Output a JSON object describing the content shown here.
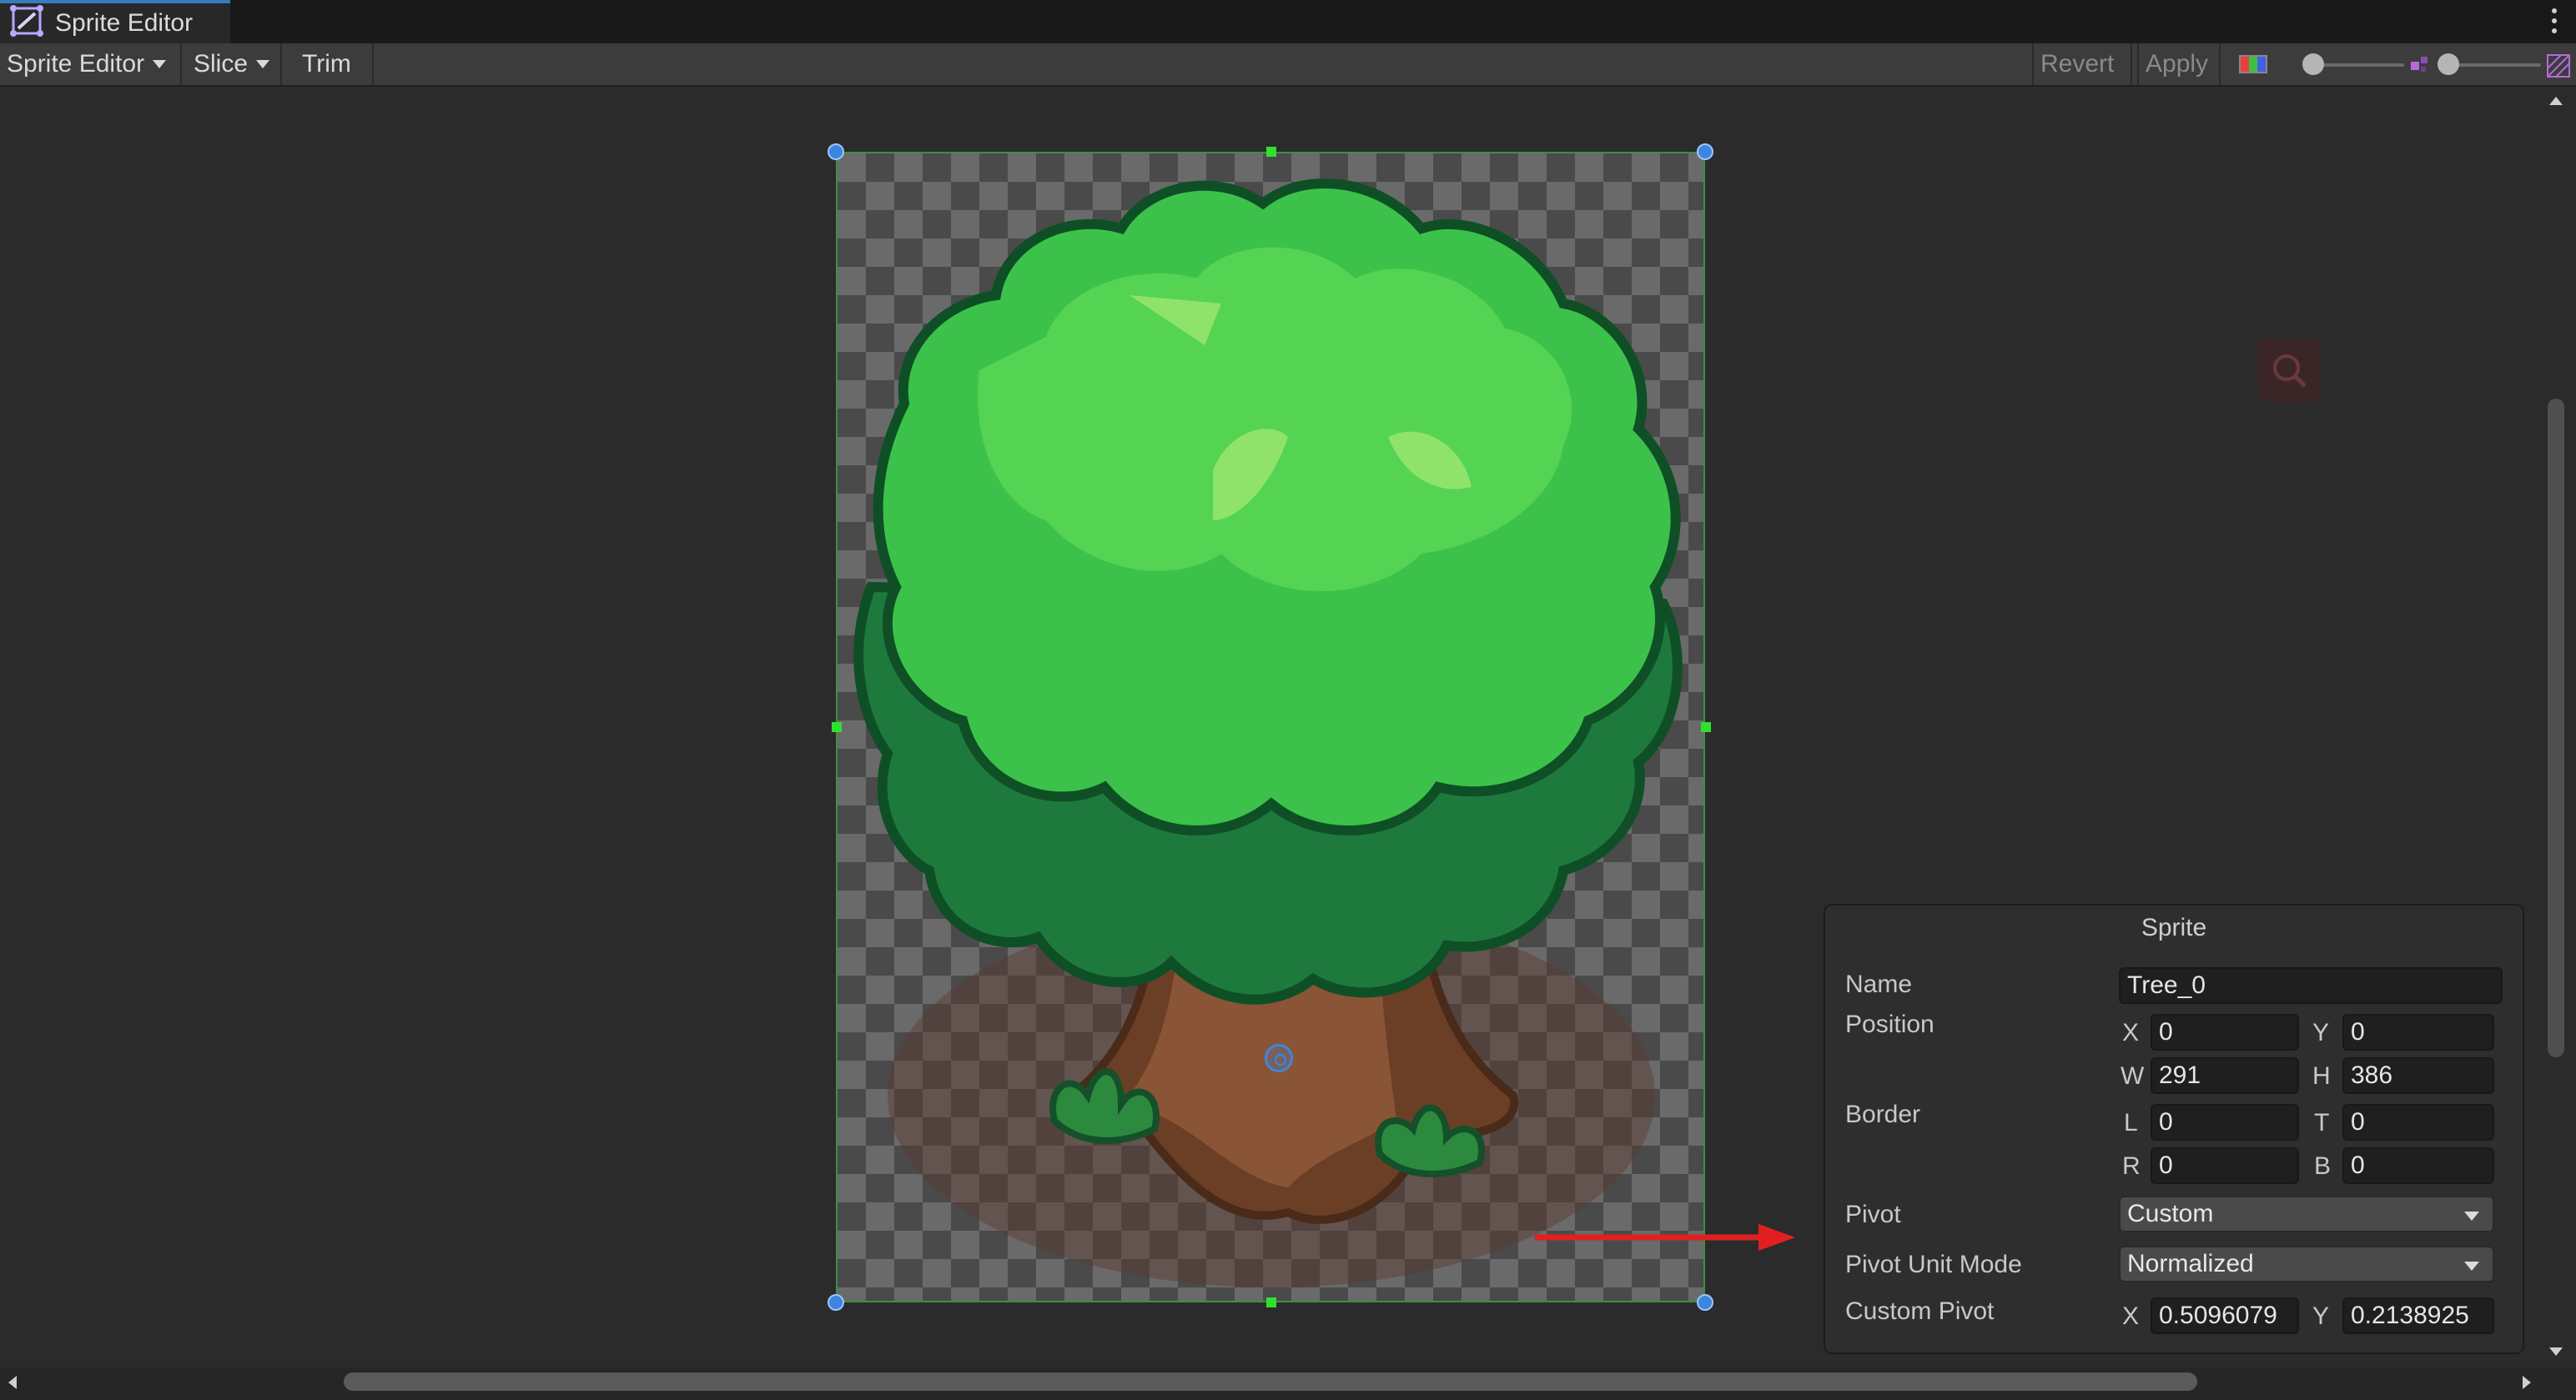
{
  "window": {
    "tab_title": "Sprite Editor",
    "tab_icon": "sprite-editor-icon"
  },
  "toolbar": {
    "mode_label": "Sprite Editor",
    "slice_label": "Slice",
    "trim_label": "Trim",
    "revert_label": "Revert",
    "apply_label": "Apply",
    "color_channel_icon": "rgb-channel-icon",
    "zoom_slider_value": 0.0,
    "mip_slider_value": 0.0,
    "alpha_icon": "alpha-toggle-icon"
  },
  "sprite_panel": {
    "title": "Sprite",
    "name_label": "Name",
    "name_value": "Tree_0",
    "position_label": "Position",
    "x_label": "X",
    "x_value": "0",
    "y_label": "Y",
    "y_value": "0",
    "w_label": "W",
    "w_value": "291",
    "h_label": "H",
    "h_value": "386",
    "border_label": "Border",
    "l_label": "L",
    "l_value": "0",
    "t_label": "T",
    "t_value": "0",
    "r_label": "R",
    "r_value": "0",
    "b_label": "B",
    "b_value": "0",
    "pivot_label": "Pivot",
    "pivot_value": "Custom",
    "pivot_unit_mode_label": "Pivot Unit Mode",
    "pivot_unit_mode_value": "Normalized",
    "custom_pivot_label": "Custom Pivot",
    "custom_pivot_x_label": "X",
    "custom_pivot_x_value": "0.5096079",
    "custom_pivot_y_label": "Y",
    "custom_pivot_y_value": "0.2138925"
  },
  "colors": {
    "accent": "#3a79bb",
    "handle_blue": "#3d86e0",
    "handle_green": "#30e030",
    "annotation_arrow": "#e02020"
  }
}
